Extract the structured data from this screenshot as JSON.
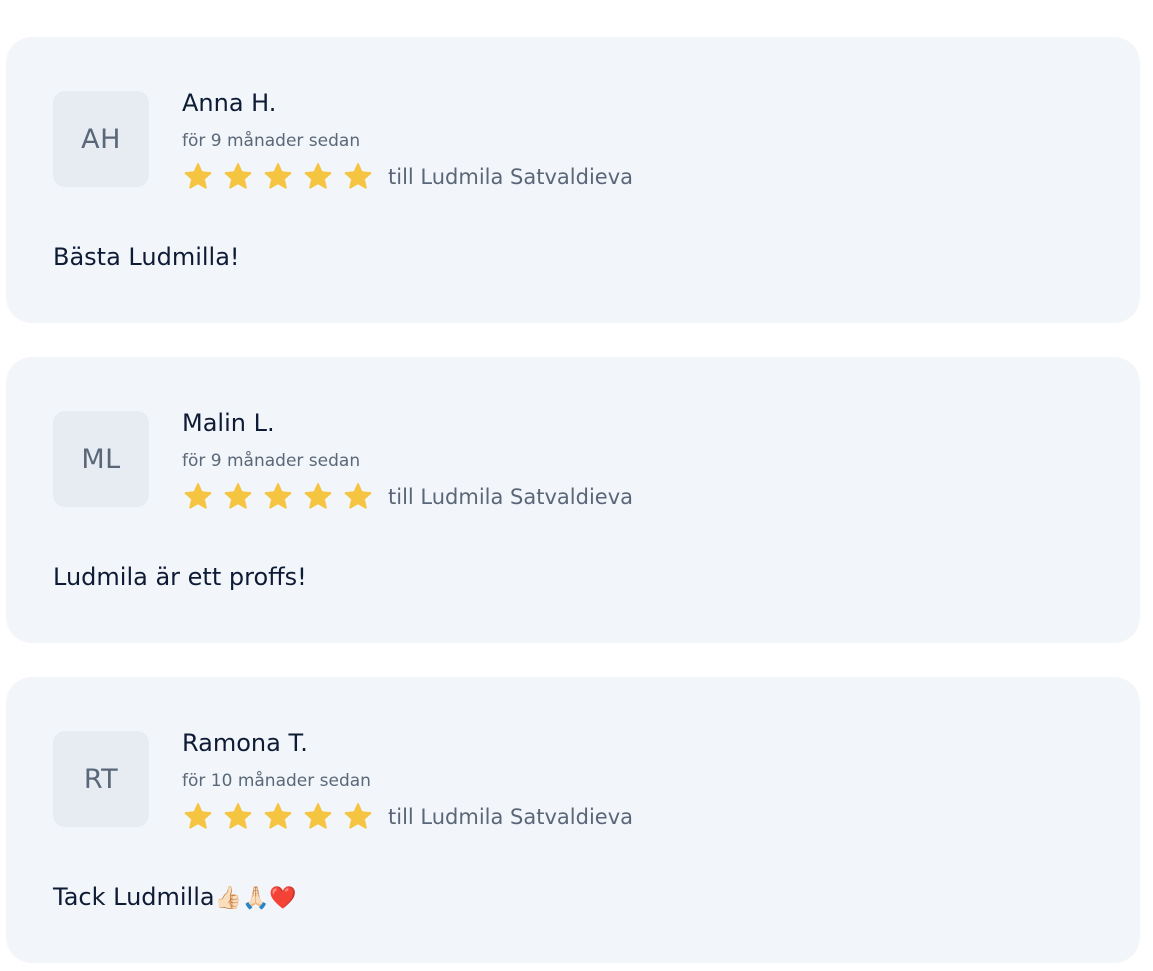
{
  "reviews": [
    {
      "initials": "AH",
      "name": "Anna H.",
      "date": "för 9 månader sedan",
      "rating": 5,
      "rating_max": 5,
      "recipient": "till Ludmila Satvaldieva",
      "text": "Bästa Ludmilla!",
      "emoji": ""
    },
    {
      "initials": "ML",
      "name": "Malin L.",
      "date": "för 9 månader sedan",
      "rating": 5,
      "rating_max": 5,
      "recipient": "till Ludmila Satvaldieva",
      "text": "Ludmila är ett proffs!",
      "emoji": ""
    },
    {
      "initials": "RT",
      "name": "Ramona T.",
      "date": "för 10 månader sedan",
      "rating": 5,
      "rating_max": 5,
      "recipient": "till Ludmila Satvaldieva",
      "text": "Tack Ludmilla",
      "emoji": "👍🏻🙏🏻❤️"
    }
  ],
  "colors": {
    "card_background": "#f2f6fa",
    "avatar_background": "#e6ecf2",
    "star": "#f5c542",
    "primary_text": "#0d1b35",
    "secondary_text": "#5a6778"
  },
  "icons": {
    "star": "star-icon"
  }
}
